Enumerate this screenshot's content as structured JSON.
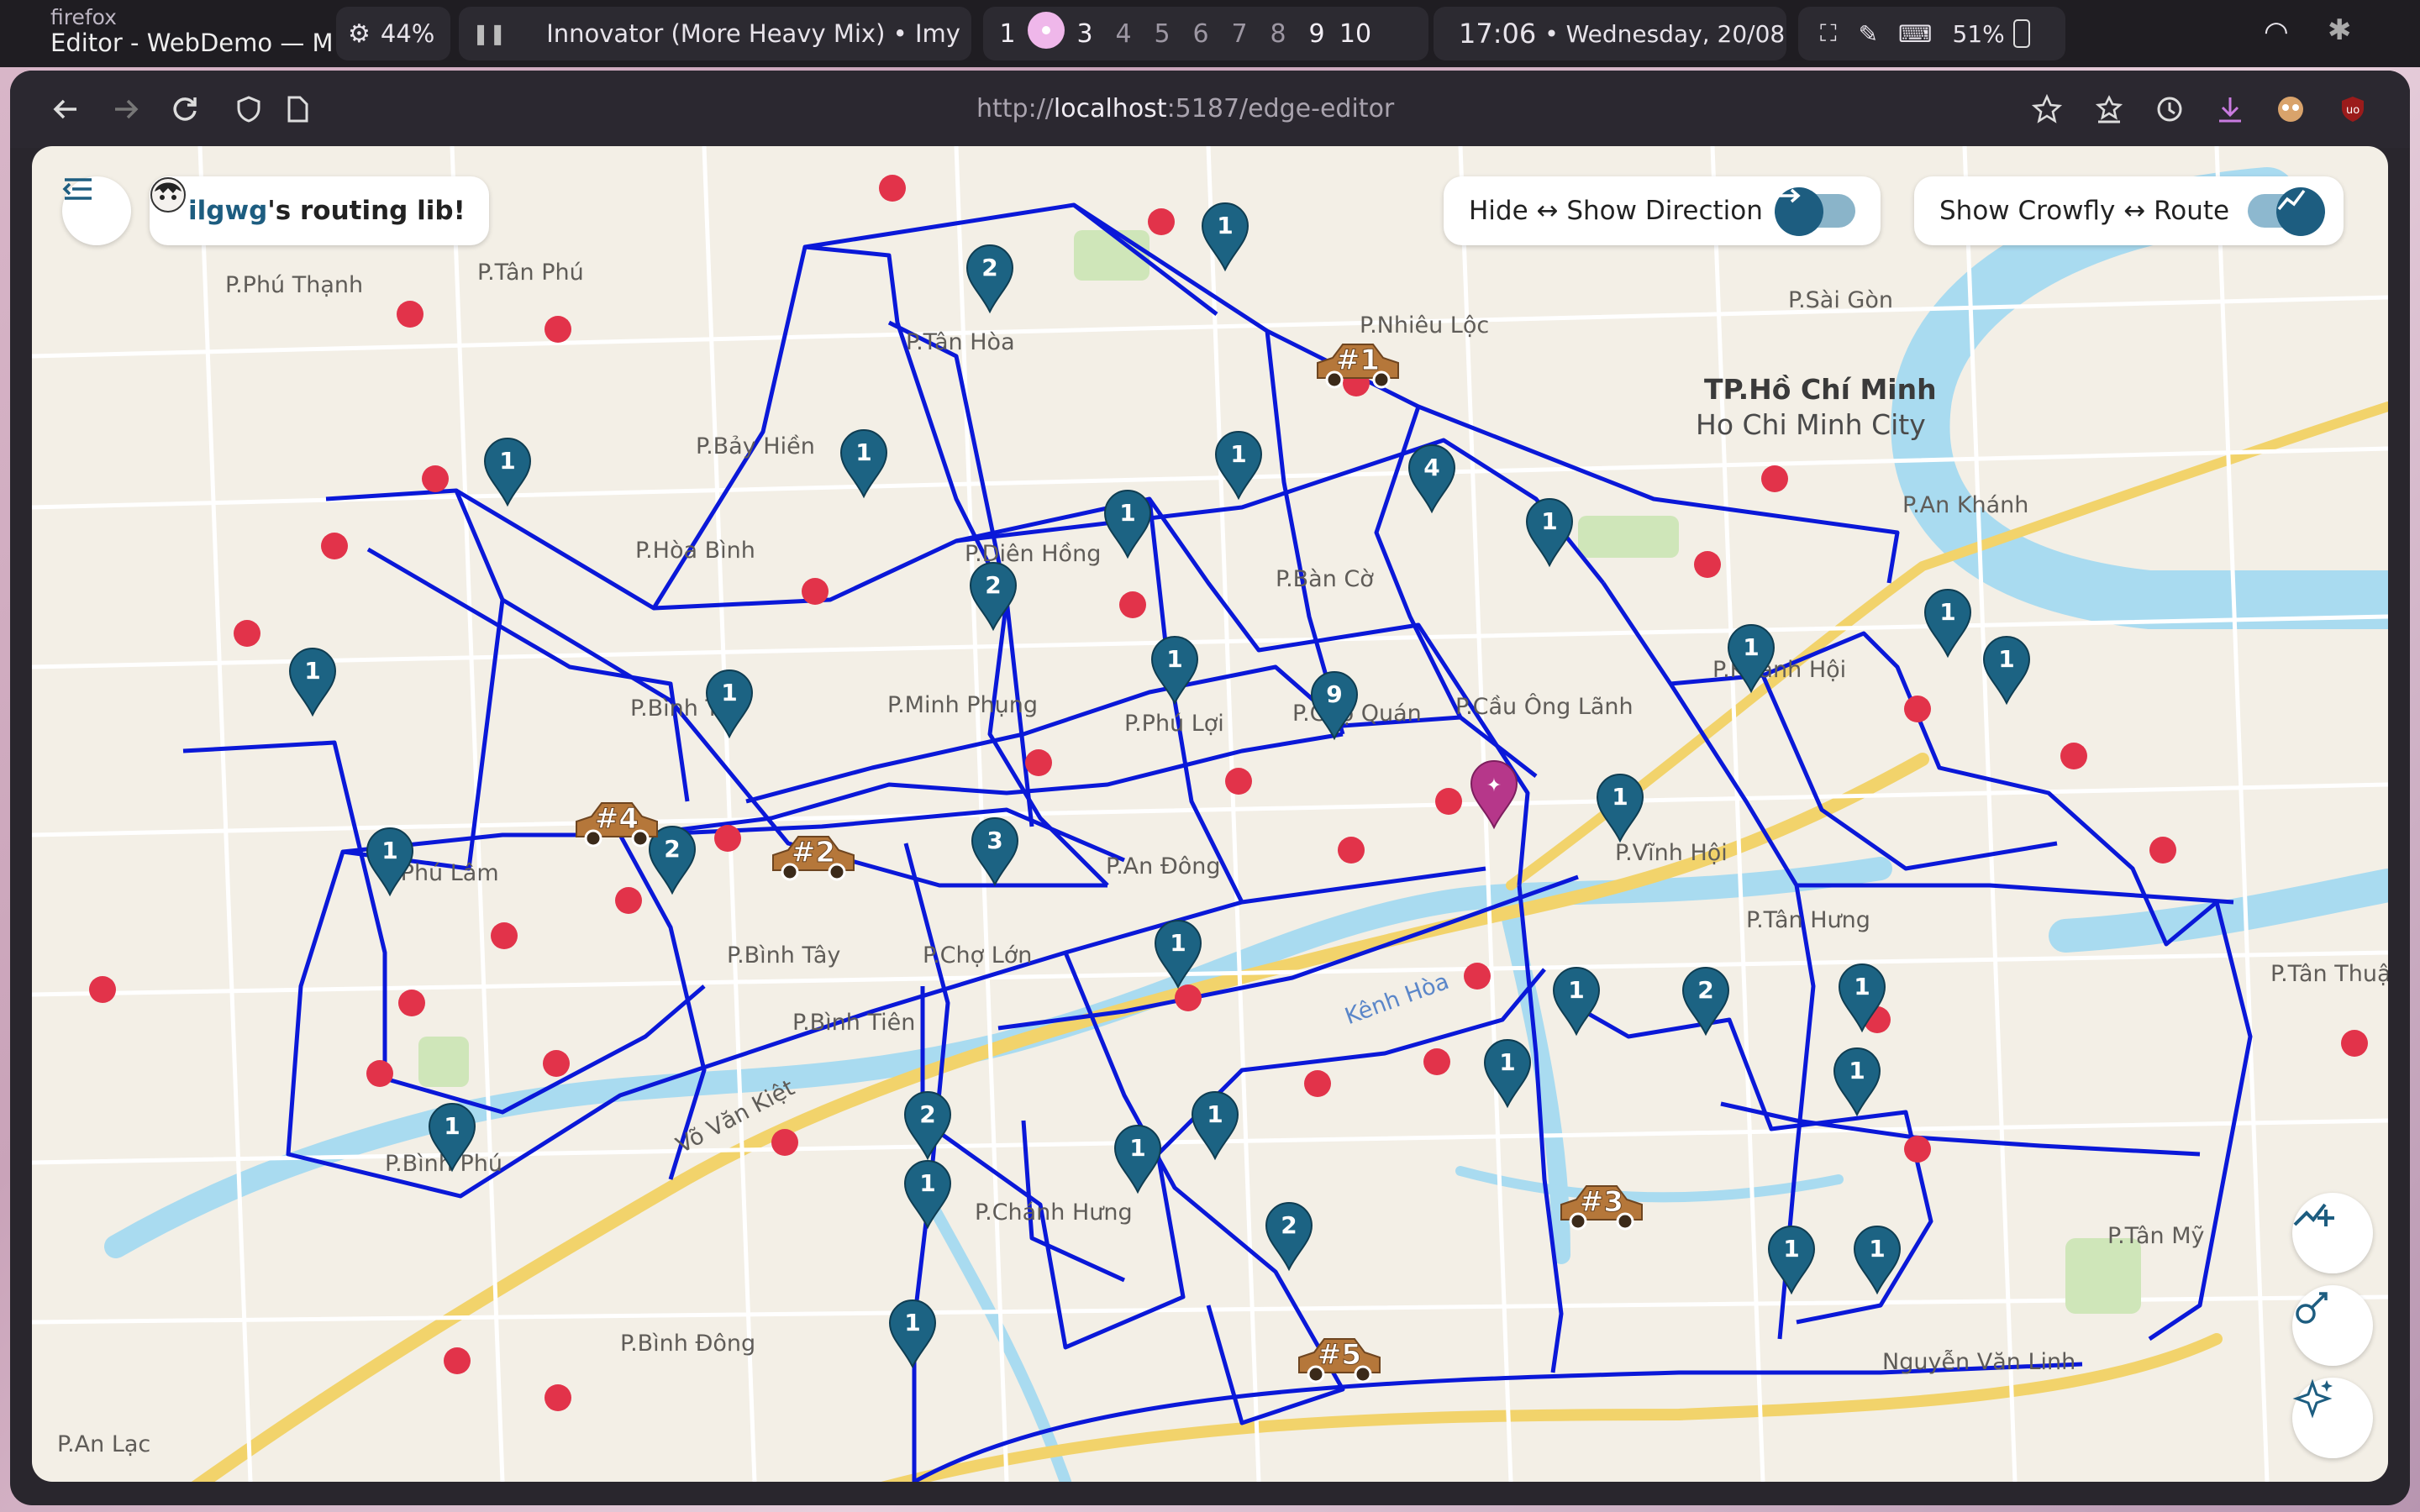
{
  "topbar": {
    "app_name": "firefox",
    "window_title": "Editor - WebDemo — Moz",
    "cpu": "44%",
    "media": "Innovator (More Heavy Mix) • Imy",
    "workspaces": [
      "1",
      "",
      "3",
      "4",
      "5",
      "6",
      "7",
      "8",
      "9",
      "10"
    ],
    "workspace_current": 2,
    "time": "17:06",
    "date": "• Wednesday, 20/08",
    "battery": "51%"
  },
  "browser": {
    "url_prefix": "http://",
    "url_host": "localhost",
    "url_rest": ":5187/edge-editor"
  },
  "overlay": {
    "brand_user": "ilgwg",
    "brand_rest": "'s routing lib!",
    "direction_toggle_label": "Hide ↔ Show Direction",
    "route_toggle_label": "Show Crowfly ↔ Route"
  },
  "map_labels": [
    "P.Phú Thạnh",
    "P.Tân Phú",
    "P.Bảy Hiền",
    "P.Hòa Bình",
    "P.Bình Trị",
    "P.Phú Lâm",
    "P.Bình Tây",
    "P.Bình Tiên",
    "P.Bình Phú",
    "P.Bình Đông",
    "P.An Lạc",
    "P.Tân Hòa",
    "P.Diên Hồng",
    "P.Minh Phụng",
    "P.Phú Lợi",
    "P.Chợ Quán",
    "P.An Đông",
    "P.Chợ Lớn",
    "P.Bàn Cờ",
    "P.Nhiêu Lộc",
    "P.Sài Gòn",
    "P.Cầu Ông Lãnh",
    "P.Vĩnh Hội",
    "P.Khánh Hội",
    "P.An Khánh",
    "P.Tân Hưng",
    "P.Tân Thuận",
    "P.Tân Mỹ",
    "P.Chánh Hưng",
    "TP.Hồ Chí Minh",
    "Ho Chi Minh City",
    "Võ Văn Kiệt",
    "Nguyễn Văn Linh",
    "Kênh Hòa"
  ],
  "markers": [
    "1",
    "2",
    "1",
    "1",
    "1",
    "1",
    "4",
    "1",
    "2",
    "1",
    "1",
    "1",
    "9",
    "1",
    "1",
    "1",
    "1",
    "1",
    "2",
    "3",
    "1",
    "1",
    "2",
    "1",
    "1",
    "1",
    "1",
    "2",
    "1",
    "1",
    "1",
    "2",
    "1",
    "1",
    "1"
  ],
  "vehicles": [
    "#1",
    "#2",
    "#3",
    "#4",
    "#5"
  ],
  "fab_icons": [
    "add-route-icon",
    "route-plan-icon",
    "magic-icon"
  ]
}
